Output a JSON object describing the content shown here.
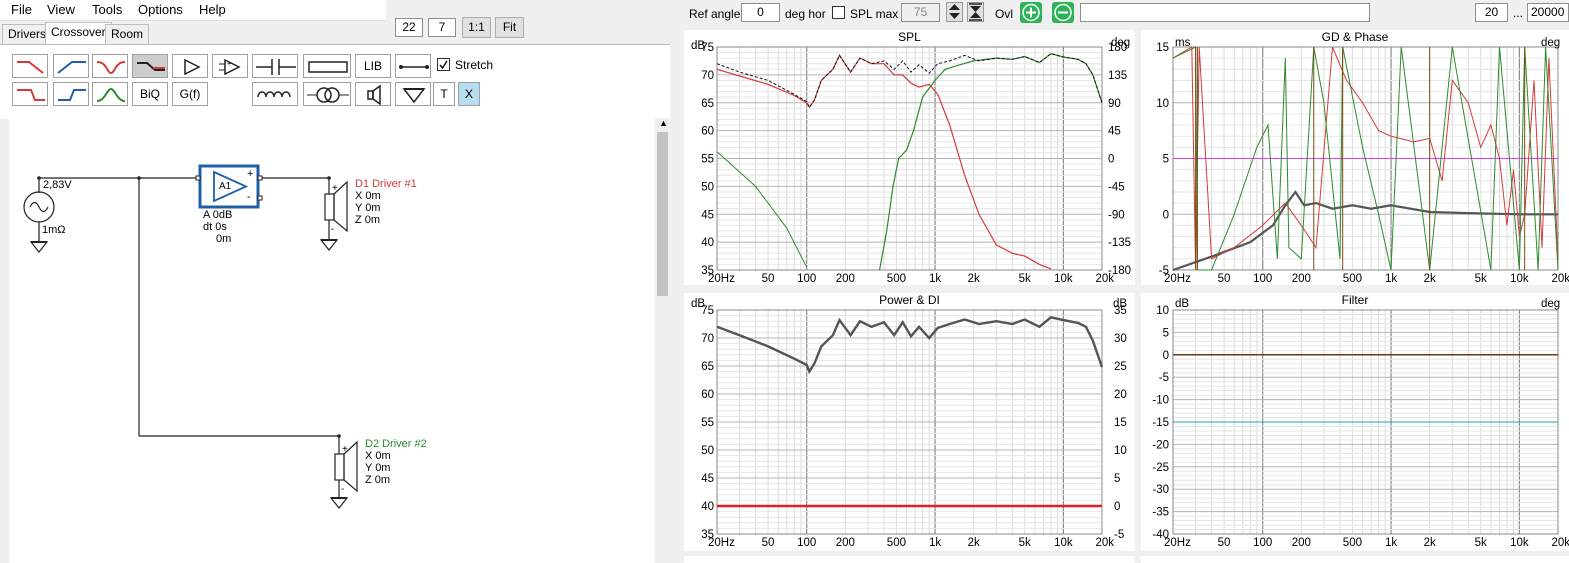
{
  "menu": [
    "File",
    "View",
    "Tools",
    "Options",
    "Help"
  ],
  "tabs": {
    "drivers": "Drivers",
    "crossover": "Crossover",
    "room": "Room"
  },
  "toolbar_top": {
    "val1": "22",
    "val2": "7",
    "one_to_one": "1:1",
    "fit": "Fit"
  },
  "palette": {
    "biq": "BiQ",
    "gf": "G(f)",
    "lib": "LIB",
    "t": "T",
    "x": "X",
    "stretch": "Stretch",
    "stretch_checked": true
  },
  "schematic": {
    "source": {
      "voltage": "2,83V",
      "impedance": "1mΩ"
    },
    "amp": {
      "label": "A1",
      "gain": "A  0dB",
      "delay": "dt 0s",
      "offset": "0m"
    },
    "d1": {
      "name": "D1 Driver #1",
      "x": "X 0m",
      "y": "Y 0m",
      "z": "Z 0m"
    },
    "d2": {
      "name": "D2 Driver #2",
      "x": "X 0m",
      "y": "Y 0m",
      "z": "Z 0m"
    }
  },
  "top_controls": {
    "ref_angle_label": "Ref angle",
    "ref_angle": "0",
    "deg_hor": "deg hor",
    "spl_max_label": "SPL max",
    "spl_max": "75",
    "ovl": "Ovl",
    "f_min": "20",
    "ellipsis": "...",
    "f_max": "20000"
  },
  "freq_ticks": [
    "20Hz",
    "50",
    "100",
    "200",
    "500",
    "1k",
    "2k",
    "5k",
    "10k",
    "20k"
  ],
  "panels": {
    "spl": {
      "title": "SPL",
      "left_unit": "dB",
      "right_unit": "deg",
      "left_ticks": [
        "75",
        "70",
        "65",
        "60",
        "55",
        "50",
        "45",
        "40",
        "35"
      ],
      "right_ticks": [
        "180",
        "135",
        "90",
        "45",
        "0",
        "-45",
        "-90",
        "-135",
        "-180"
      ]
    },
    "gd": {
      "title": "GD & Phase",
      "left_unit": "ms",
      "right_unit": "deg",
      "left_ticks": [
        "15",
        "10",
        "5",
        "0",
        "-5"
      ]
    },
    "power": {
      "title": "Power & DI",
      "left_unit": "dB",
      "right_unit": "dB",
      "left_ticks": [
        "75",
        "70",
        "65",
        "60",
        "55",
        "50",
        "45",
        "40",
        "35"
      ],
      "right_ticks": [
        "35",
        "30",
        "25",
        "20",
        "15",
        "10",
        "5",
        "0",
        "-5"
      ]
    },
    "filter": {
      "title": "Filter",
      "left_unit": "dB",
      "right_unit": "deg",
      "left_ticks": [
        "10",
        "5",
        "0",
        "-5",
        "-10",
        "-15",
        "-20",
        "-25",
        "-30",
        "-35",
        "-40"
      ]
    }
  },
  "colors": {
    "red": "#d23b3b",
    "green": "#2e8b2e",
    "blue": "#1f5fa8",
    "gray": "#555555",
    "magenta": "#e040e0",
    "teal": "#2aa0a0",
    "grid": "#c8c8c8"
  }
}
